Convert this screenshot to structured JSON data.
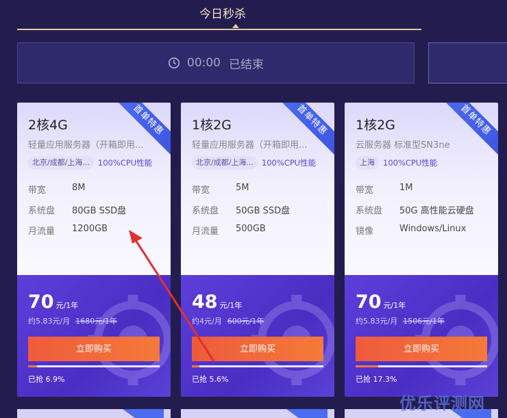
{
  "tab": {
    "label": "今日秒杀"
  },
  "timer": {
    "time": "00:00",
    "status": "已结束"
  },
  "cards": [
    {
      "title": "2核4G",
      "subtitle": "轻量应用服务器（开箱即用...",
      "region": "北京/成都/上海...",
      "cpu": "100%CPU性能",
      "ribbon": "首单特惠",
      "specs": [
        {
          "label": "带宽",
          "value": "8M"
        },
        {
          "label": "系统盘",
          "value": "80GB SSD盘"
        },
        {
          "label": "月流量",
          "value": "1200GB"
        }
      ],
      "price": "70",
      "unit": "元/1年",
      "monthly": "约5.83元/月",
      "original": "1680元/1年",
      "buy": "立即购买",
      "progress": 6.9,
      "sold": "已抢 6.9%"
    },
    {
      "title": "1核2G",
      "subtitle": "轻量应用服务器（开箱即用...",
      "region": "北京/成都/上海...",
      "cpu": "100%CPU性能",
      "ribbon": "首单特惠",
      "specs": [
        {
          "label": "带宽",
          "value": "5M"
        },
        {
          "label": "系统盘",
          "value": "50GB SSD盘"
        },
        {
          "label": "月流量",
          "value": "500GB"
        }
      ],
      "price": "48",
      "unit": "元/1年",
      "monthly": "约4元/月",
      "original": "600元/1年",
      "buy": "立即购买",
      "progress": 5.6,
      "sold": "已抢 5.6%"
    },
    {
      "title": "1核2G",
      "subtitle": "云服务器 标准型SN3ne",
      "region": "上海",
      "cpu": "100%CPU性能",
      "ribbon": "首单特惠",
      "specs": [
        {
          "label": "带宽",
          "value": "1M"
        },
        {
          "label": "系统盘",
          "value": "50G 高性能云硬盘"
        },
        {
          "label": "镜像",
          "value": "Windows/Linux"
        }
      ],
      "price": "70",
      "unit": "元/1年",
      "monthly": "约5.83元/月",
      "original": "1506元/1年",
      "buy": "立即购买",
      "progress": 17.3,
      "sold": "已抢 17.3%"
    }
  ],
  "watermark": "优乐评测网",
  "colors": {
    "background": "#231d4f",
    "accent_gold": "#e7c9a0",
    "buy_button": "#f0633b",
    "ribbon": "#4c6cf0",
    "arrow": "#e03030"
  }
}
